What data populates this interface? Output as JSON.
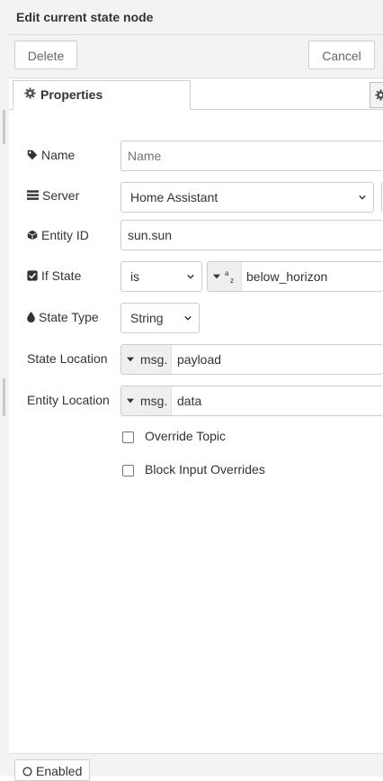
{
  "header": {
    "title": "Edit current state node"
  },
  "toolbar": {
    "delete_label": "Delete",
    "cancel_label": "Cancel"
  },
  "tabs": [
    {
      "label": "Properties",
      "icon": "cog-icon"
    }
  ],
  "form": {
    "name": {
      "label": "Name",
      "icon": "tag-icon",
      "placeholder": "Name",
      "value": ""
    },
    "server": {
      "label": "Server",
      "icon": "server-icon",
      "value": "Home Assistant"
    },
    "entity_id": {
      "label": "Entity ID",
      "icon": "cube-icon",
      "value": "sun.sun"
    },
    "if_state": {
      "label": "If State",
      "icon": "check-square-icon",
      "operator": "is",
      "type_icon": "az",
      "value": "below_horizon"
    },
    "state_type": {
      "label": "State Type",
      "icon": "tint-icon",
      "value": "String"
    },
    "state_location": {
      "label": "State Location",
      "prefix": "msg.",
      "value": "payload"
    },
    "entity_location": {
      "label": "Entity Location",
      "prefix": "msg.",
      "value": "data"
    },
    "override_topic": {
      "label": "Override Topic",
      "checked": false
    },
    "block_input_overrides": {
      "label": "Block Input Overrides",
      "checked": false
    }
  },
  "footer": {
    "enabled_label": "Enabled"
  }
}
